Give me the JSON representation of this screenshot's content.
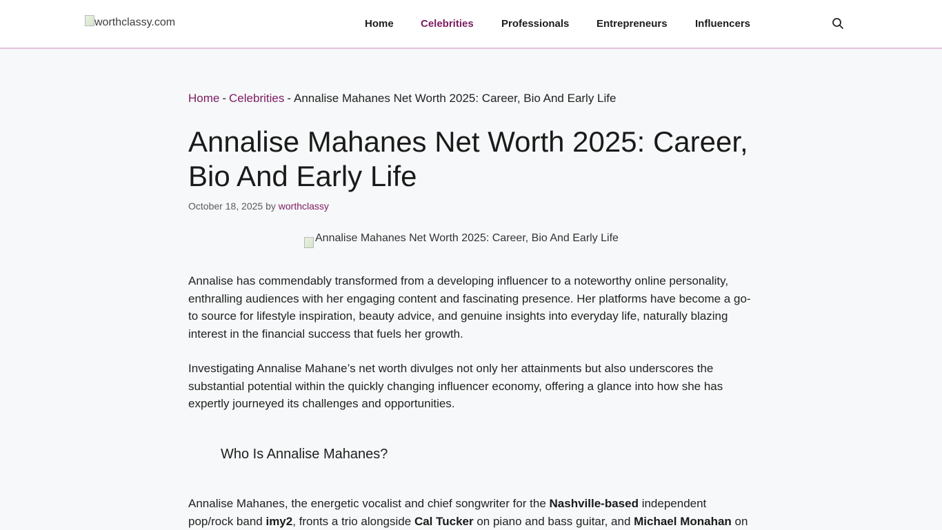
{
  "header": {
    "logo_alt": "worthclassy.com",
    "nav": [
      {
        "label": "Home",
        "active": false
      },
      {
        "label": "Celebrities",
        "active": true
      },
      {
        "label": "Professionals",
        "active": false
      },
      {
        "label": "Entrepreneurs",
        "active": false
      },
      {
        "label": "Influencers",
        "active": false
      }
    ],
    "search_icon": "search-icon"
  },
  "breadcrumb": {
    "home": "Home",
    "category": "Celebrities",
    "current": "Annalise Mahanes Net Worth 2025: Career, Bio And Early Life",
    "separator": "-"
  },
  "article": {
    "title": "Annalise Mahanes Net Worth 2025: Career, Bio And Early Life",
    "date": "October 18, 2025",
    "by": "by",
    "author": "worthclassy",
    "featured_alt": "Annalise Mahanes Net Worth 2025: Career, Bio And Early Life",
    "paragraph_1": "Annalise has commendably transformed from a developing influencer to a noteworthy online personality, enthralling audiences with her engaging content and fascinating presence. Her platforms have become a go-to source for lifestyle inspiration, beauty advice, and genuine insights into everyday life, naturally blazing interest in the financial success that fuels her growth.",
    "paragraph_2": "Investigating Annalise Mahane’s net worth divulges not only her attainments but also underscores the substantial potential within the quickly changing influencer economy, offering a glance into how she has expertly journeyed its challenges and opportunities.",
    "heading_1": "Who Is Annalise Mahanes?",
    "paragraph_3": {
      "t1": "Annalise Mahanes, the energetic vocalist and chief songwriter for the ",
      "b1": "Nashville-based",
      "t2": " independent pop/rock band ",
      "b2": "imy2",
      "t3": ", fronts a trio alongside ",
      "b3": "Cal Tucker",
      "t4": " on piano and bass guitar, and ",
      "b4": "Michael Monahan",
      "t5": " on"
    }
  },
  "colors": {
    "accent": "#7b1b61",
    "header_border": "#e8bfdf",
    "background": "#f7f8f9"
  }
}
